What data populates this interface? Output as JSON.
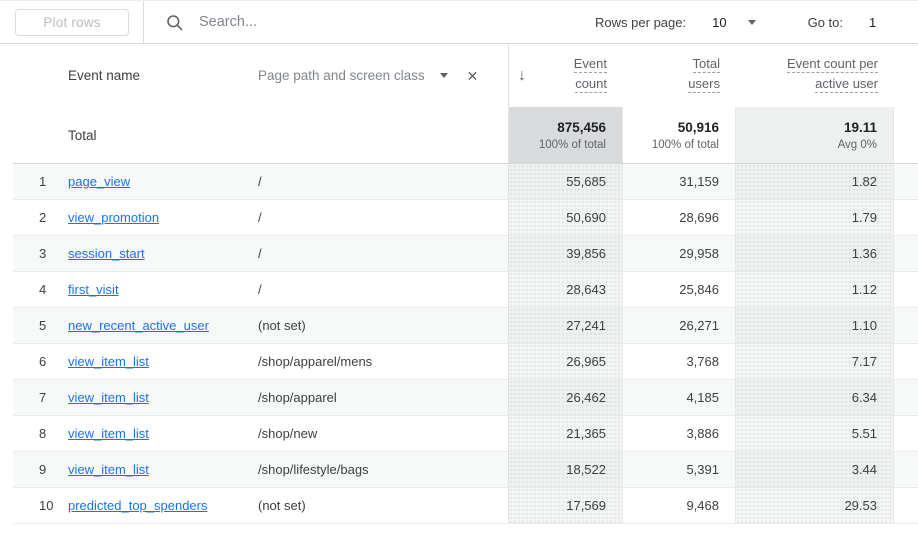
{
  "toolbar": {
    "plot_rows_label": "Plot rows",
    "search_placeholder": "Search...",
    "rows_per_page_label": "Rows per page:",
    "rows_per_page_value": "10",
    "go_to_label": "Go to:",
    "go_to_value": "1"
  },
  "table": {
    "dimension_headers": {
      "event_name": "Event name",
      "page_path": "Page path and screen class"
    },
    "metric_headers": [
      {
        "line1": "Event",
        "line2": "count"
      },
      {
        "line1": "Total",
        "line2": "users"
      },
      {
        "line1": "Event count per",
        "line2": "active user"
      }
    ],
    "sort_icon": "↓",
    "close_icon": "✕",
    "total": {
      "label": "Total",
      "metrics": [
        {
          "value": "875,456",
          "sub": "100% of total"
        },
        {
          "value": "50,916",
          "sub": "100% of total"
        },
        {
          "value": "19.11",
          "sub": "Avg 0%"
        }
      ]
    },
    "rows": [
      {
        "num": "1",
        "event": "page_view",
        "path": "/",
        "event_count": "55,685",
        "total_users": "31,159",
        "per_active_user": "1.82"
      },
      {
        "num": "2",
        "event": "view_promotion",
        "path": "/",
        "event_count": "50,690",
        "total_users": "28,696",
        "per_active_user": "1.79"
      },
      {
        "num": "3",
        "event": "session_start",
        "path": "/",
        "event_count": "39,856",
        "total_users": "29,958",
        "per_active_user": "1.36"
      },
      {
        "num": "4",
        "event": "first_visit",
        "path": "/",
        "event_count": "28,643",
        "total_users": "25,846",
        "per_active_user": "1.12"
      },
      {
        "num": "5",
        "event": "new_recent_active_user",
        "path": "(not set)",
        "event_count": "27,241",
        "total_users": "26,271",
        "per_active_user": "1.10"
      },
      {
        "num": "6",
        "event": "view_item_list",
        "path": "/shop/apparel/mens",
        "event_count": "26,965",
        "total_users": "3,768",
        "per_active_user": "7.17"
      },
      {
        "num": "7",
        "event": "view_item_list",
        "path": "/shop/apparel",
        "event_count": "26,462",
        "total_users": "4,185",
        "per_active_user": "6.34"
      },
      {
        "num": "8",
        "event": "view_item_list",
        "path": "/shop/new",
        "event_count": "21,365",
        "total_users": "3,886",
        "per_active_user": "5.51"
      },
      {
        "num": "9",
        "event": "view_item_list",
        "path": "/shop/lifestyle/bags",
        "event_count": "18,522",
        "total_users": "5,391",
        "per_active_user": "3.44"
      },
      {
        "num": "10",
        "event": "predicted_top_spenders",
        "path": "(not set)",
        "event_count": "17,569",
        "total_users": "9,468",
        "per_active_user": "29.53"
      }
    ]
  },
  "colors": {
    "link_blue": "#1a73e8",
    "header_grey": "#5f6368",
    "sorted_total_cell_bg": "#d9dadb",
    "row_stripe_bg": "#f7f8f8"
  }
}
